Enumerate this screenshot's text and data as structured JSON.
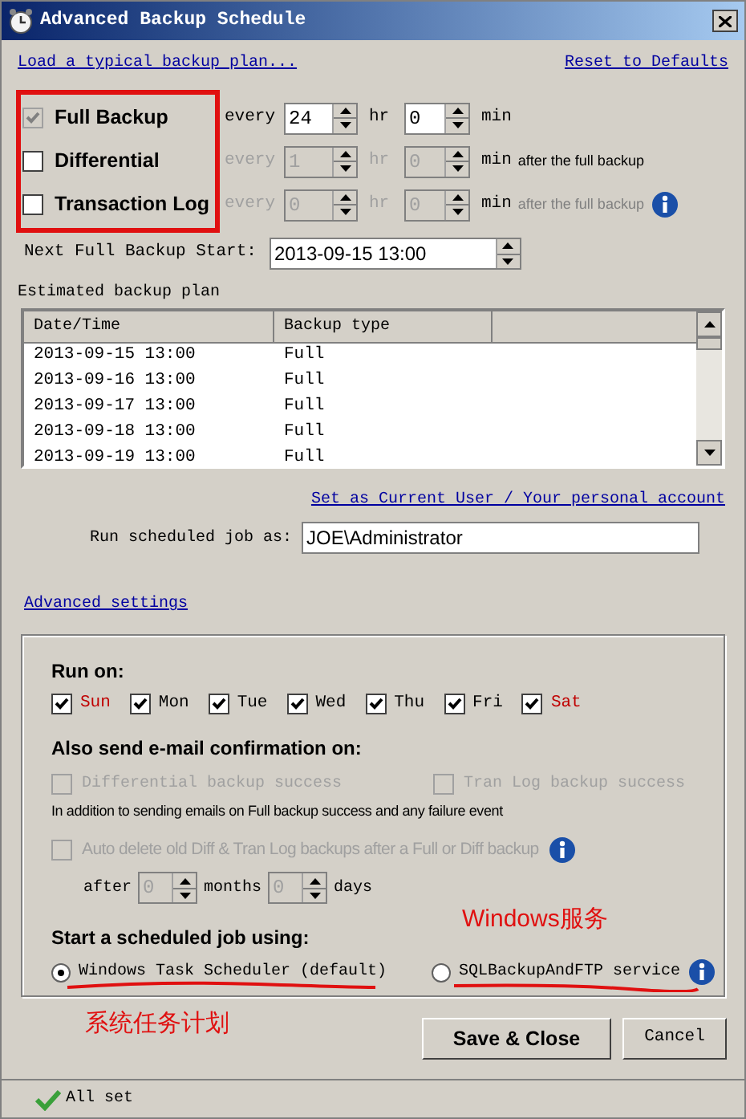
{
  "window": {
    "title": "Advanced Backup Schedule"
  },
  "links": {
    "load_plan": "Load a typical backup plan...",
    "reset": "Reset to Defaults"
  },
  "schedule": [
    {
      "label": "Full Backup",
      "checked": true,
      "checkbox_disabled": true,
      "fields_disabled": false,
      "every": "every",
      "hours": "24",
      "hr": "hr",
      "minutes": "0",
      "min": "min",
      "info": false
    },
    {
      "label": "Differential",
      "checked": false,
      "checkbox_disabled": false,
      "fields_disabled": true,
      "every": "every",
      "hours": "1",
      "hr": "hr",
      "minutes": "0",
      "min": "min",
      "note": "after the full backup",
      "info": false
    },
    {
      "label": "Transaction Log",
      "checked": false,
      "checkbox_disabled": false,
      "fields_disabled": true,
      "every": "every",
      "hours": "0",
      "hr": "hr",
      "minutes": "0",
      "min": "min",
      "note": "after the full backup",
      "info": true
    }
  ],
  "next_full": {
    "label": "Next Full Backup Start:",
    "value": "2013-09-15 13:00"
  },
  "plan": {
    "label": "Estimated backup plan",
    "columns": [
      "Date/Time",
      "Backup type"
    ],
    "rows": [
      [
        "2013-09-15 13:00",
        "Full"
      ],
      [
        "2013-09-16 13:00",
        "Full"
      ],
      [
        "2013-09-17 13:00",
        "Full"
      ],
      [
        "2013-09-18 13:00",
        "Full"
      ],
      [
        "2013-09-19 13:00",
        "Full"
      ]
    ]
  },
  "account": {
    "link": "Set as Current User / Your personal account",
    "label": "Run scheduled job as:",
    "value": "JOE\\Administrator"
  },
  "advanced_link": "Advanced settings",
  "run_on": {
    "heading": "Run on:",
    "days": [
      {
        "label": "Sun",
        "checked": true,
        "color": "#c00000"
      },
      {
        "label": "Mon",
        "checked": true,
        "color": "#000000"
      },
      {
        "label": "Tue",
        "checked": true,
        "color": "#000000"
      },
      {
        "label": "Wed",
        "checked": true,
        "color": "#000000"
      },
      {
        "label": "Thu",
        "checked": true,
        "color": "#000000"
      },
      {
        "label": "Fri",
        "checked": true,
        "color": "#000000"
      },
      {
        "label": "Sat",
        "checked": true,
        "color": "#c00000"
      }
    ]
  },
  "email": {
    "heading": "Also send e-mail confirmation on:",
    "options": [
      {
        "label": "Differential backup success",
        "checked": false,
        "disabled": true
      },
      {
        "label": "Tran Log backup success",
        "checked": false,
        "disabled": true
      }
    ],
    "note": "In addition to sending emails on Full backup success and any failure event"
  },
  "auto_delete": {
    "label": "Auto delete old Diff & Tran Log backups after a Full or Diff backup",
    "checked": false,
    "disabled": true,
    "after": "after",
    "months": "0",
    "months_label": "months",
    "days": "0",
    "days_label": "days"
  },
  "start_using": {
    "heading": "Start a scheduled job using:",
    "options": [
      {
        "label": "Windows Task Scheduler (default)",
        "selected": true,
        "info": false
      },
      {
        "label": "SQLBackupAndFTP service",
        "selected": false,
        "info": true
      }
    ]
  },
  "annotations": [
    {
      "text": "Windows服务"
    },
    {
      "text": "系统任务计划"
    }
  ],
  "buttons": [
    "Save & Close",
    "Cancel"
  ],
  "status_bar": {
    "text": "All set"
  }
}
